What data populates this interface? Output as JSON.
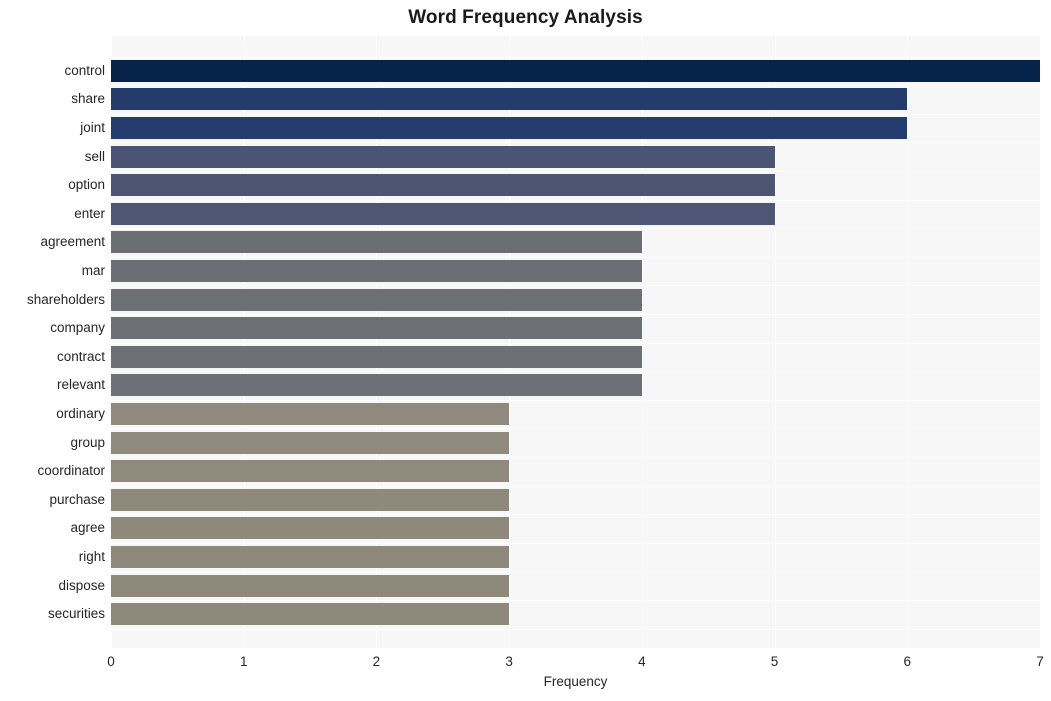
{
  "chart_data": {
    "type": "bar",
    "orientation": "horizontal",
    "title": "Word Frequency Analysis",
    "xlabel": "Frequency",
    "ylabel": "",
    "xlim": [
      0,
      7
    ],
    "xticks": [
      "0",
      "1",
      "2",
      "3",
      "4",
      "5",
      "6",
      "7"
    ],
    "grid": true,
    "legend": null,
    "categories": [
      "control",
      "share",
      "joint",
      "sell",
      "option",
      "enter",
      "agreement",
      "mar",
      "shareholders",
      "company",
      "contract",
      "relevant",
      "ordinary",
      "group",
      "coordinator",
      "purchase",
      "agree",
      "right",
      "dispose",
      "securities"
    ],
    "values": [
      7,
      6,
      6,
      5,
      5,
      5,
      4,
      4,
      4,
      4,
      4,
      4,
      3,
      3,
      3,
      3,
      3,
      3,
      3,
      3
    ],
    "bar_colors": [
      "#06244a",
      "#243c6c",
      "#253d6e",
      "#4b5472",
      "#4c5573",
      "#4d5674",
      "#6b6e73",
      "#6b6e73",
      "#6c6f74",
      "#6c6f74",
      "#6c6f74",
      "#6d7075",
      "#8f8a7d",
      "#8f8a7d",
      "#8f8a7c",
      "#8e897b",
      "#8e897b",
      "#8e897b",
      "#8e897b",
      "#8e897b"
    ],
    "colors": {
      "plot_background": "#f7f7f7",
      "figure_background": "#ffffff",
      "gridline": "#ffffff",
      "text": "#262626",
      "title": "#1a1a1a"
    }
  }
}
